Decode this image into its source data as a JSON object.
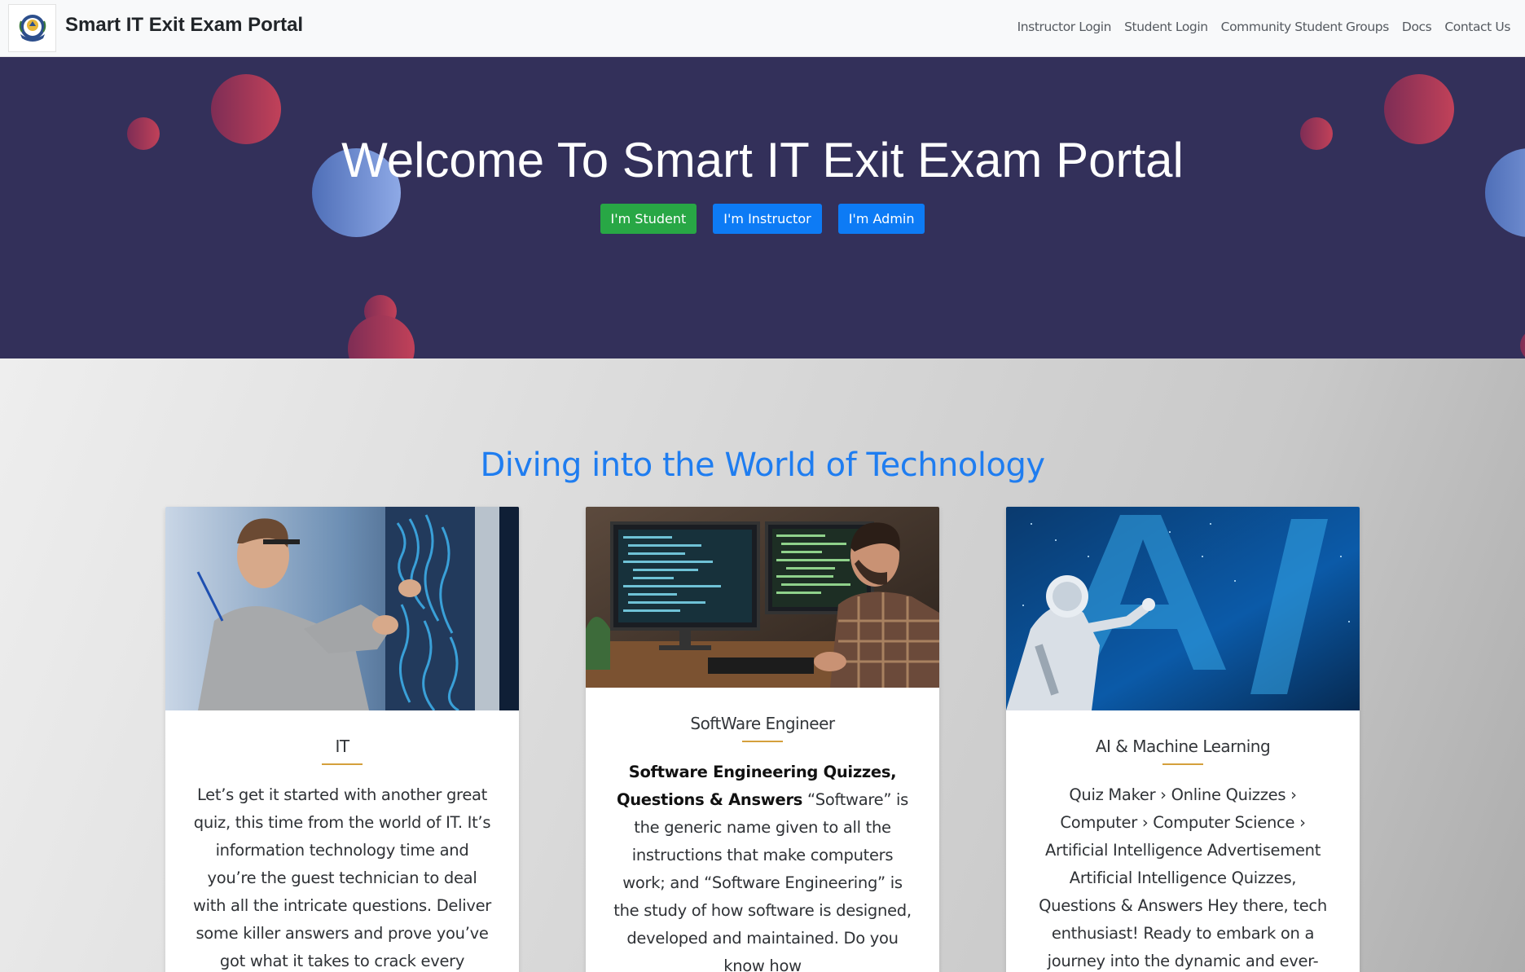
{
  "navbar": {
    "brand": "Smart IT Exit Exam Portal",
    "links": [
      "Instructor Login",
      "Student Login",
      "Community Student Groups",
      "Docs",
      "Contact Us"
    ]
  },
  "hero": {
    "title": "Welcome To Smart IT Exit Exam Portal",
    "buttons": {
      "student": "I'm Student",
      "instructor": "I'm Instructor",
      "admin": "I'm Admin"
    }
  },
  "section": {
    "title": "Diving into the World of Technology",
    "cards": [
      {
        "title": "IT",
        "text": "Let’s get it started with another great quiz, this time from the world of IT. It’s information technology time and you’re the guest technician to deal with all the intricate questions. Deliver some killer answers and prove you’ve got what it takes to crack every answer correct"
      },
      {
        "title": "SoftWare Engineer",
        "bold": "Software Engineering Quizzes, Questions & Answers",
        "text": " “Software” is the generic name given to all the instructions that make computers work; and “Software Engineering” is the study of how software is designed, developed and maintained. Do you know how"
      },
      {
        "title": "AI & Machine Learning",
        "text": "Quiz Maker › Online Quizzes › Computer › Computer Science › Artificial Intelligence Advertisement Artificial Intelligence Quizzes, Questions & Answers Hey there, tech enthusiast! Ready to embark on a journey into the dynamic and ever-evolving world of"
      }
    ]
  },
  "colors": {
    "hero_bg": "#33305a",
    "accent_blue": "#1f7df0",
    "student_green": "#28a745",
    "button_blue": "#0d7bf5",
    "underline_gold": "#d4a03c"
  }
}
